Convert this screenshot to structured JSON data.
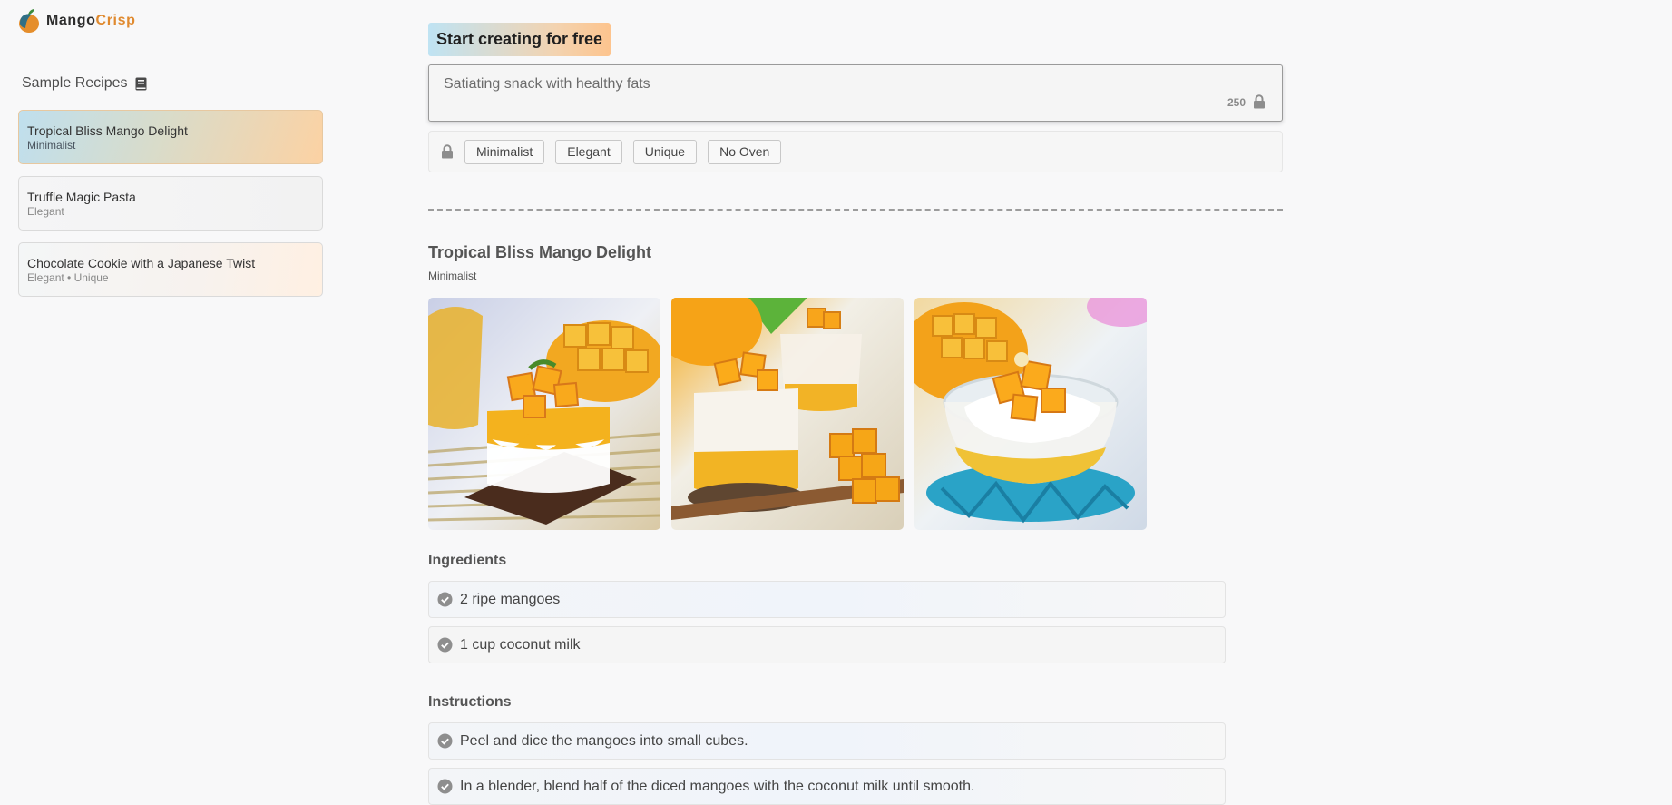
{
  "brand": {
    "name_part1": "Mango",
    "name_part2": "Crisp"
  },
  "sidebar": {
    "title": "Sample Recipes",
    "recipes": [
      {
        "name": "Tropical Bliss Mango Delight",
        "tags": "Minimalist",
        "active": true
      },
      {
        "name": "Truffle Magic Pasta",
        "tags": "Elegant"
      },
      {
        "name": "Chocolate Cookie with a Japanese Twist",
        "tags": "Elegant • Unique"
      }
    ]
  },
  "creator": {
    "cta_label": "Start creating for free",
    "prompt_value": "Satiating snack with healthy fats",
    "char_count": "250",
    "style_chips": [
      "Minimalist",
      "Elegant",
      "Unique",
      "No Oven"
    ]
  },
  "recipe_detail": {
    "title": "Tropical Bliss Mango Delight",
    "tag": "Minimalist",
    "images": [
      "mango-cube-glass-photo",
      "mango-parfait-cups-photo",
      "mango-bowl-photo"
    ],
    "ingredients_heading": "Ingredients",
    "ingredients": [
      "2 ripe mangoes",
      "1 cup coconut milk"
    ],
    "instructions_heading": "Instructions",
    "instructions": [
      "Peel and dice the mangoes into small cubes.",
      "In a blender, blend half of the diced mangoes with the coconut milk until smooth."
    ]
  },
  "colors": {
    "accent_orange": "#e08a2f",
    "active_card_gradient_start": "#bfdfee",
    "active_card_gradient_end": "#fcd2a3"
  }
}
